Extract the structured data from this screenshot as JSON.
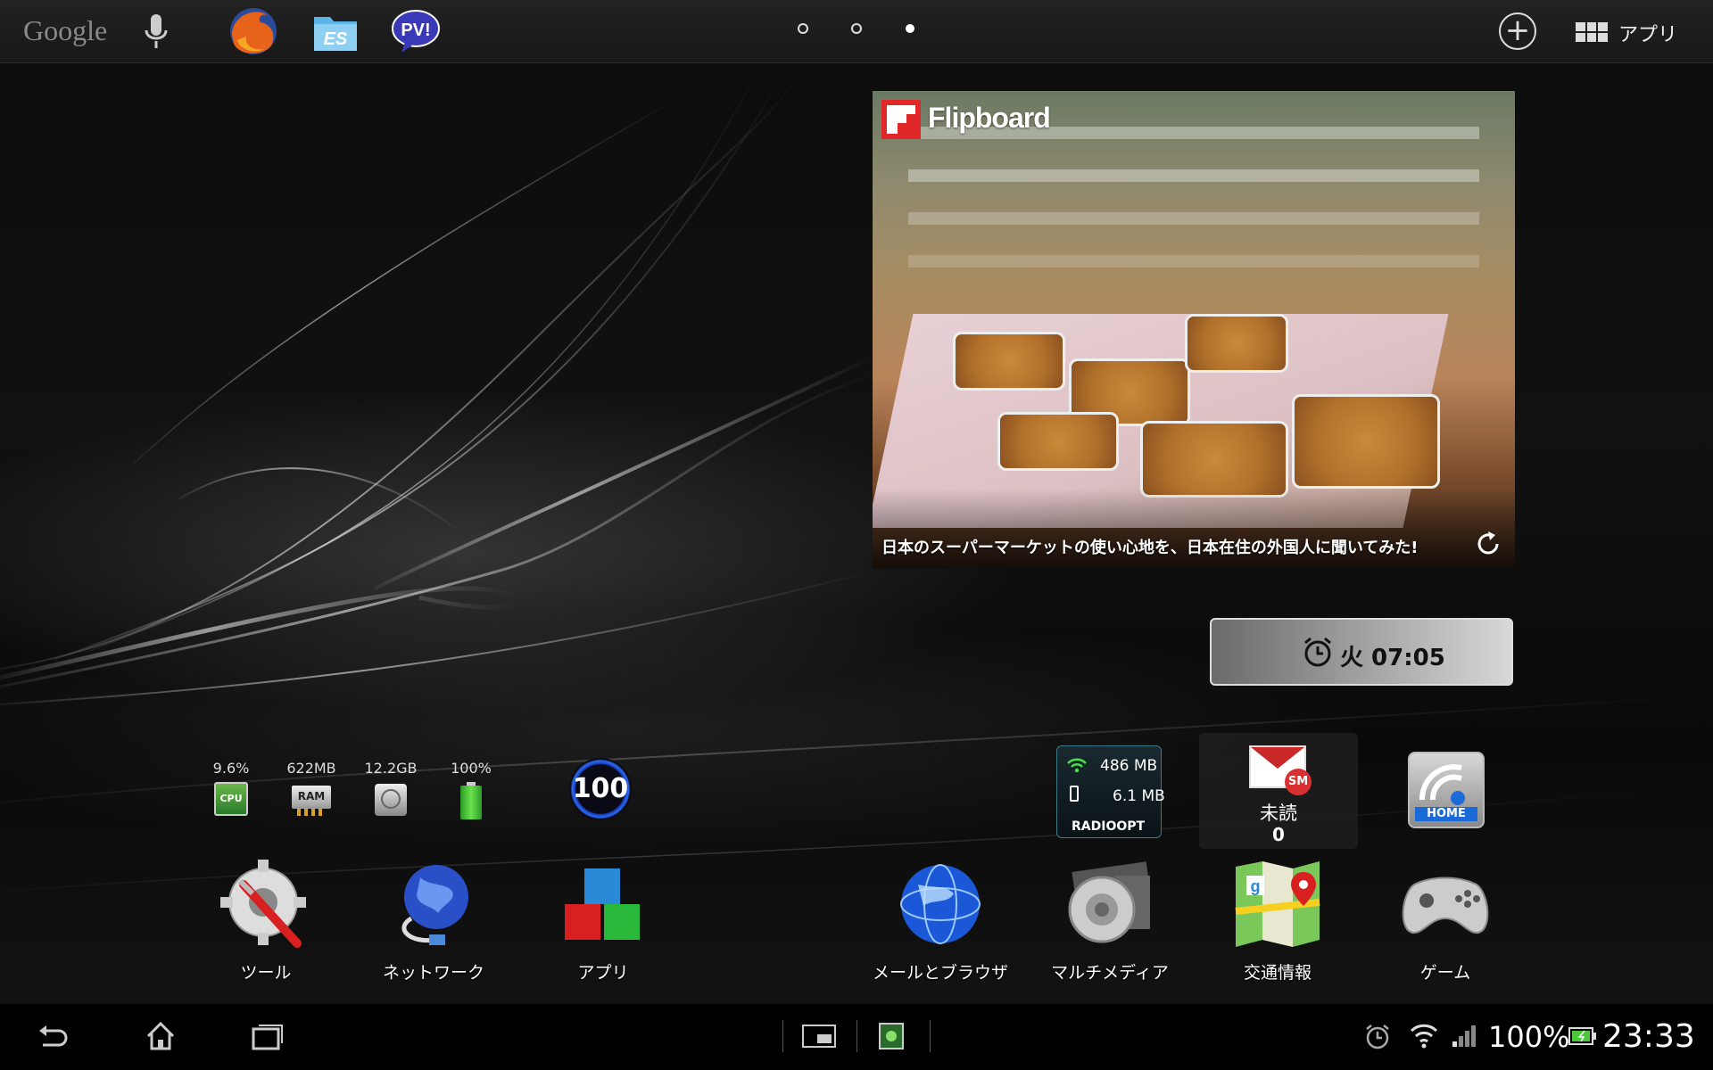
{
  "topbar": {
    "search_brand": "Google",
    "mic_icon": "microphone-icon",
    "pinned_apps": [
      {
        "name": "Firefox",
        "icon": "firefox-icon"
      },
      {
        "name": "ES File Explorer",
        "icon": "es-file-explorer-icon",
        "badge": "ES"
      },
      {
        "name": "PV!",
        "icon": "pv-app-icon",
        "badge": "PV!"
      }
    ],
    "page_dots": 3,
    "active_page": 3,
    "add_icon": "plus-circle-icon",
    "apps_label": "アプリ"
  },
  "flipboard": {
    "brand": "Flipboard",
    "caption": "日本のスーパーマーケットの使い心地を、日本在住の外国人に聞いてみた!",
    "refresh_icon": "refresh-icon"
  },
  "alarm": {
    "icon": "alarm-clock-icon",
    "text": "火 07:05"
  },
  "system_stats": [
    {
      "value": "9.6%",
      "icon": "cpu-icon",
      "icon_label": "CPU"
    },
    {
      "value": "622MB",
      "icon": "ram-icon",
      "icon_label": "RAM"
    },
    {
      "value": "12.2GB",
      "icon": "storage-icon"
    },
    {
      "value": "100%",
      "icon": "battery-icon"
    }
  ],
  "badge_100": "100",
  "radioopt": {
    "wifi_usage": "486 MB",
    "mobile_usage": "6.1 MB",
    "brand": "RADIOOPT"
  },
  "mail": {
    "label": "未読",
    "count": "0",
    "sm_badge": "SM"
  },
  "home_widget": {
    "label": "HOME"
  },
  "folders": [
    {
      "label": "ツール",
      "icon": "tools-gear-icon"
    },
    {
      "label": "ネットワーク",
      "icon": "network-globe-icon"
    },
    {
      "label": "アプリ",
      "icon": "apps-cubes-icon"
    },
    {
      "label": "メールとブラウザ",
      "icon": "globe-icon"
    },
    {
      "label": "マルチメディア",
      "icon": "multimedia-speaker-icon"
    },
    {
      "label": "交通情報",
      "icon": "maps-icon"
    },
    {
      "label": "ゲーム",
      "icon": "gamepad-icon"
    }
  ],
  "navbar": {
    "back_icon": "back-icon",
    "home_icon": "home-icon",
    "recents_icon": "recent-apps-icon",
    "small_app_icon": "small-apps-icon",
    "screenshot_icon": "screenshot-icon",
    "battery_percent": "100%",
    "time": "23:33"
  },
  "colors": {
    "accent_blue": "#2a6af0",
    "mail_red": "#c82828",
    "flipboard_red": "#e12828",
    "battery_green": "#4ac83a"
  }
}
